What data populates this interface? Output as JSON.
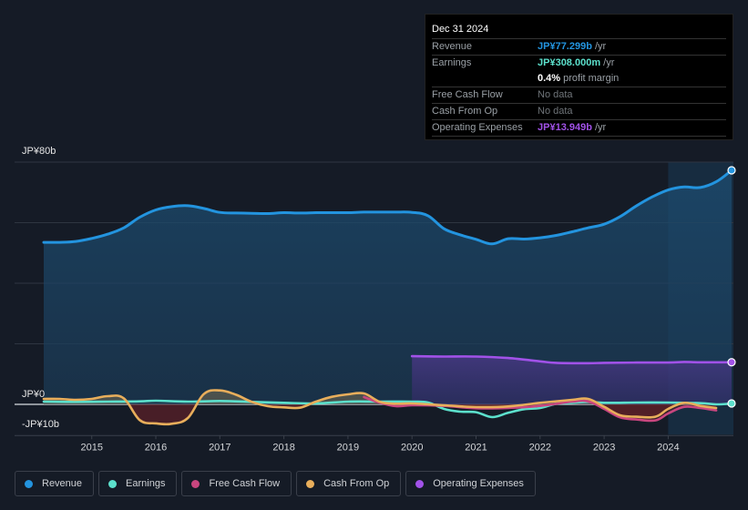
{
  "tooltip": {
    "date": "Dec 31 2024",
    "rows": [
      {
        "label": "Revenue",
        "value": "JP¥77.299b",
        "suffix": " /yr",
        "color": "#2394df"
      },
      {
        "label": "Earnings",
        "value": "JP¥308.000m",
        "suffix": " /yr",
        "color": "#5ce0cc"
      },
      {
        "label": "",
        "value": "0.4%",
        "suffix": " profit margin",
        "color": "#ffffff"
      },
      {
        "label": "Free Cash Flow",
        "value": "",
        "suffix": "No data",
        "color": "#6f7479"
      },
      {
        "label": "Cash From Op",
        "value": "",
        "suffix": "No data",
        "color": "#6f7479"
      },
      {
        "label": "Operating Expenses",
        "value": "JP¥13.949b",
        "suffix": " /yr",
        "color": "#a152e8"
      }
    ]
  },
  "chart_data": {
    "type": "area",
    "title": "",
    "xlabel": "",
    "ylabel": "",
    "currency": "JPY",
    "ylim": [
      -10,
      80
    ],
    "xlim": [
      2014.25,
      2024.99
    ],
    "y_axis_labels": [
      {
        "value": 80,
        "label": "JP¥80b"
      },
      {
        "value": 0,
        "label": "JP¥0"
      },
      {
        "value": -10,
        "label": "-JP¥10b"
      }
    ],
    "gridlines": [
      80,
      60,
      40,
      20,
      0
    ],
    "x_ticks": [
      2015,
      2016,
      2017,
      2018,
      2019,
      2020,
      2021,
      2022,
      2023,
      2024
    ],
    "x_tick_labels": [
      "2015",
      "2016",
      "2017",
      "2018",
      "2019",
      "2020",
      "2021",
      "2022",
      "2023",
      "2024"
    ],
    "highlight_from": 2024.0,
    "legend_position": "bottom-left",
    "series": [
      {
        "name": "Revenue",
        "color": "#2394df",
        "unit": "JP¥b",
        "x": [
          2014.25,
          2014.5,
          2014.75,
          2015.0,
          2015.25,
          2015.5,
          2015.75,
          2016.0,
          2016.25,
          2016.5,
          2016.75,
          2017.0,
          2017.25,
          2017.5,
          2017.75,
          2018.0,
          2018.25,
          2018.5,
          2018.75,
          2019.0,
          2019.25,
          2019.5,
          2019.75,
          2020.0,
          2020.25,
          2020.5,
          2020.75,
          2021.0,
          2021.25,
          2021.5,
          2021.75,
          2022.0,
          2022.25,
          2022.5,
          2022.75,
          2023.0,
          2023.25,
          2023.5,
          2023.75,
          2024.0,
          2024.25,
          2024.5,
          2024.75,
          2024.99
        ],
        "values": [
          53.5,
          53.5,
          53.8,
          54.8,
          56.2,
          58.3,
          61.8,
          64.2,
          65.3,
          65.6,
          64.7,
          63.4,
          63.2,
          63.1,
          63.0,
          63.3,
          63.2,
          63.3,
          63.3,
          63.3,
          63.5,
          63.5,
          63.5,
          63.4,
          62.3,
          58.0,
          56.0,
          54.5,
          53.0,
          54.7,
          54.6,
          55.0,
          55.8,
          57.0,
          58.3,
          59.5,
          62.0,
          65.5,
          68.5,
          70.8,
          71.8,
          71.6,
          73.5,
          77.3
        ]
      },
      {
        "name": "Earnings",
        "color": "#5ce0cc",
        "unit": "JP¥b",
        "x": [
          2014.25,
          2014.75,
          2015.25,
          2015.75,
          2016.0,
          2016.5,
          2017.0,
          2017.5,
          2018.0,
          2018.5,
          2019.0,
          2019.5,
          2020.0,
          2020.25,
          2020.5,
          2020.75,
          2021.0,
          2021.25,
          2021.5,
          2021.75,
          2022.0,
          2022.25,
          2022.5,
          2022.75,
          2023.0,
          2023.5,
          2024.0,
          2024.5,
          2024.75,
          2024.99
        ],
        "values": [
          0.9,
          0.8,
          0.9,
          1.0,
          1.2,
          0.9,
          1.1,
          0.8,
          0.5,
          0.3,
          0.9,
          0.9,
          0.9,
          0.6,
          -1.5,
          -2.4,
          -2.6,
          -4.2,
          -2.8,
          -1.6,
          -1.2,
          0.2,
          0.5,
          0.8,
          0.5,
          0.6,
          0.6,
          0.4,
          0.0,
          0.3
        ]
      },
      {
        "name": "Free Cash Flow",
        "color": "#c9467f",
        "unit": "JP¥b",
        "x": [
          2019.25,
          2019.5,
          2019.75,
          2020.0,
          2020.5,
          2021.0,
          2021.5,
          2022.0,
          2022.5,
          2022.75,
          2023.0,
          2023.25,
          2023.5,
          2023.8,
          2024.0,
          2024.25,
          2024.5,
          2024.75
        ],
        "values": [
          2.4,
          0.5,
          -0.6,
          -0.3,
          -0.5,
          -1.3,
          -1.2,
          -0.5,
          0.9,
          1.0,
          -1.5,
          -4.3,
          -5.0,
          -5.3,
          -3.0,
          -0.8,
          -1.2,
          -2.0
        ]
      },
      {
        "name": "Cash From Op",
        "color": "#e8ae5b",
        "unit": "JP¥b",
        "x": [
          2014.25,
          2014.5,
          2014.75,
          2015.0,
          2015.25,
          2015.5,
          2015.75,
          2016.0,
          2016.25,
          2016.5,
          2016.75,
          2017.0,
          2017.25,
          2017.5,
          2017.75,
          2018.0,
          2018.25,
          2018.5,
          2018.75,
          2019.0,
          2019.25,
          2019.5,
          2019.75,
          2020.0,
          2020.5,
          2021.0,
          2021.5,
          2022.0,
          2022.5,
          2022.75,
          2023.0,
          2023.25,
          2023.5,
          2023.8,
          2024.0,
          2024.25,
          2024.5,
          2024.75
        ],
        "values": [
          1.8,
          1.8,
          1.5,
          1.8,
          2.7,
          2.0,
          -5.2,
          -6.3,
          -6.4,
          -4.5,
          3.4,
          4.6,
          3.2,
          0.8,
          -0.6,
          -1.0,
          -1.1,
          0.9,
          2.5,
          3.3,
          3.6,
          0.8,
          0.2,
          0.3,
          -0.3,
          -0.9,
          -0.7,
          0.5,
          1.5,
          1.8,
          -0.8,
          -3.6,
          -4.1,
          -4.1,
          -1.5,
          0.5,
          -0.5,
          -1.2
        ]
      },
      {
        "name": "Operating Expenses",
        "color": "#a152e8",
        "unit": "JP¥b",
        "x": [
          2020.0,
          2020.5,
          2021.0,
          2021.5,
          2022.0,
          2022.25,
          2022.75,
          2023.0,
          2023.5,
          2024.0,
          2024.25,
          2024.5,
          2024.99
        ],
        "values": [
          15.9,
          15.8,
          15.8,
          15.3,
          14.2,
          13.7,
          13.6,
          13.7,
          13.8,
          13.8,
          14.0,
          13.9,
          13.9
        ]
      }
    ]
  },
  "legend": [
    {
      "label": "Revenue",
      "color": "#2394df"
    },
    {
      "label": "Earnings",
      "color": "#5ce0cc"
    },
    {
      "label": "Free Cash Flow",
      "color": "#c9467f"
    },
    {
      "label": "Cash From Op",
      "color": "#e8ae5b"
    },
    {
      "label": "Operating Expenses",
      "color": "#a152e8"
    }
  ]
}
